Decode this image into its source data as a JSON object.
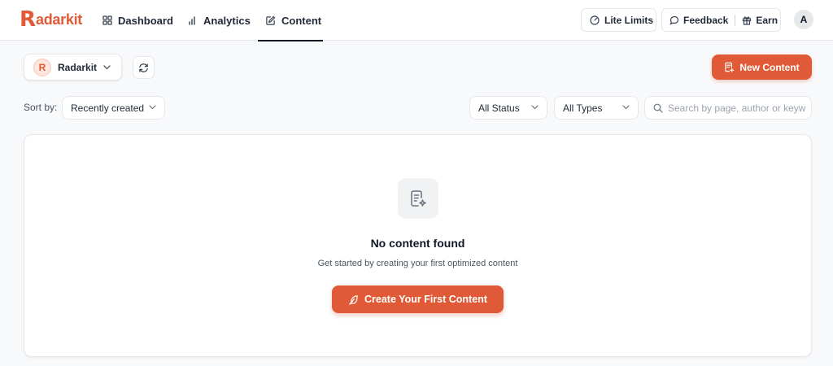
{
  "brand": {
    "logo_letter": "R",
    "name": "adarkit",
    "accent": "#e05a37"
  },
  "nav": {
    "tabs": [
      {
        "label": "Dashboard",
        "icon": "grid-icon"
      },
      {
        "label": "Analytics",
        "icon": "bar-chart-icon"
      },
      {
        "label": "Content",
        "icon": "edit-icon",
        "active": true
      }
    ]
  },
  "header_actions": {
    "lite_limits": "Lite Limits",
    "feedback": "Feedback",
    "earn": "Earn",
    "avatar_initial": "A"
  },
  "toolbar": {
    "project_name": "Radarkit",
    "project_logo_letter": "R",
    "new_content_label": "New Content"
  },
  "filters": {
    "sort_label": "Sort by:",
    "sort_value": "Recently created",
    "status_value": "All Status",
    "types_value": "All Types",
    "search_placeholder": "Search by page, author or keywords"
  },
  "empty_state": {
    "title": "No content found",
    "subtitle": "Get started by creating your first optimized content",
    "cta_label": "Create Your First Content",
    "icon": "document-sparkle-icon"
  }
}
